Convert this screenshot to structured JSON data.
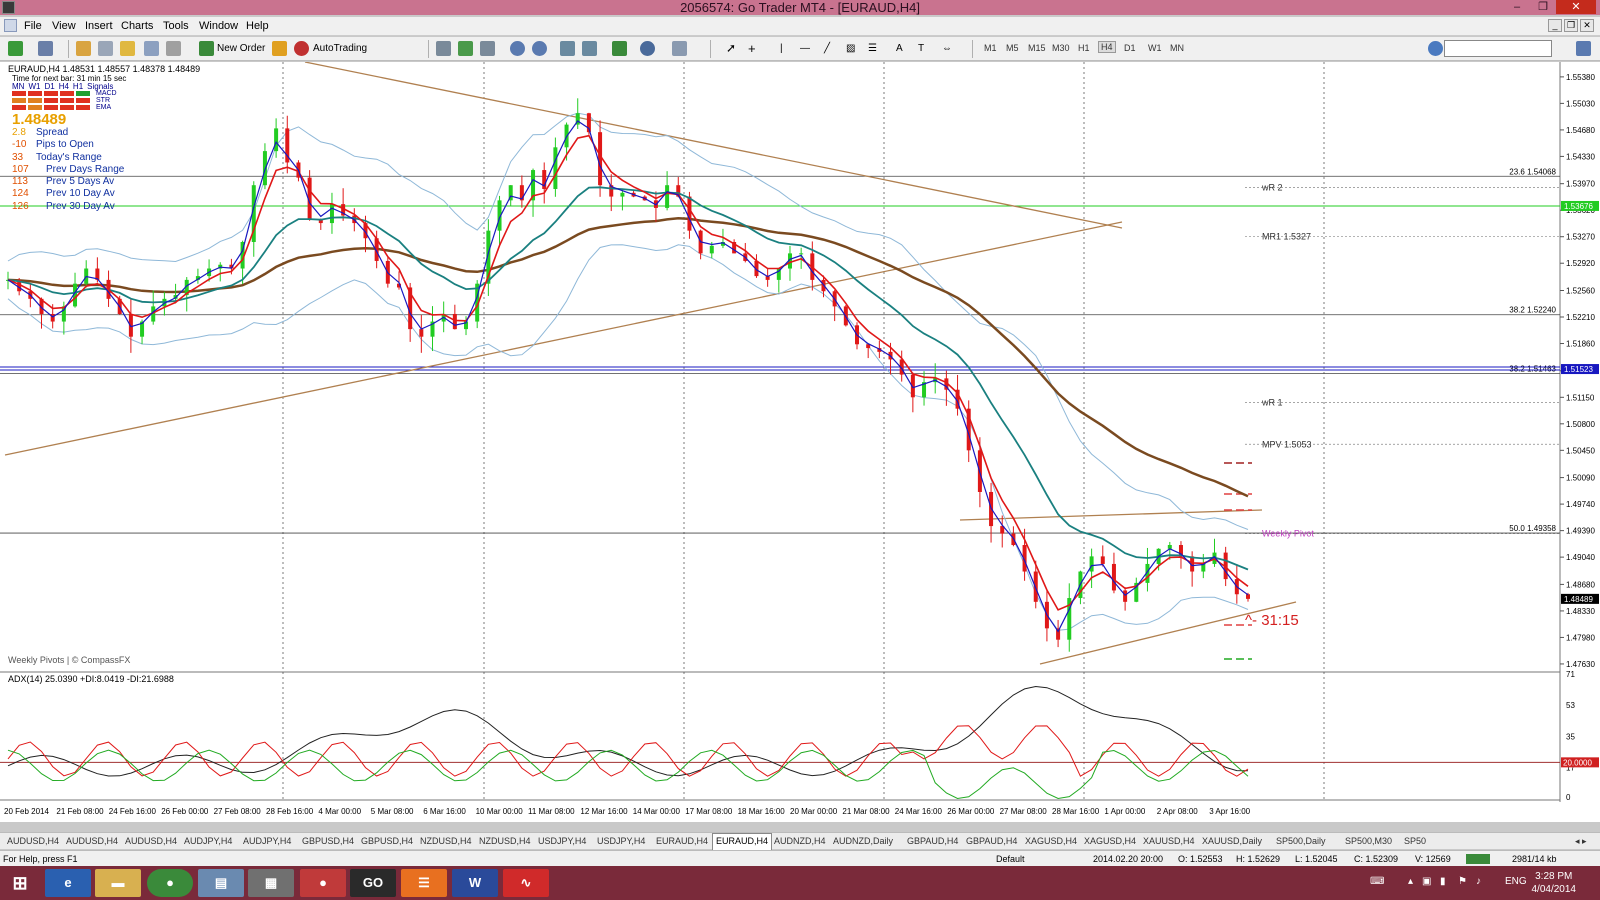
{
  "window": {
    "title": "2056574: Go Trader MT4 - [EURAUD,H4]",
    "buttons": [
      "–",
      "❐",
      "✕"
    ]
  },
  "menu": [
    "File",
    "View",
    "Insert",
    "Charts",
    "Tools",
    "Window",
    "Help"
  ],
  "toolbar": {
    "new_order": "New Order",
    "autotrading": "AutoTrading",
    "timeframes": [
      "M1",
      "M5",
      "M15",
      "M30",
      "H1",
      "H4",
      "D1",
      "W1",
      "MN"
    ],
    "active_timeframe": "H4"
  },
  "chart": {
    "symbol_line": "EURAUD,H4  1.48531 1.48557 1.48378 1.48489",
    "next_bar": "Time for next bar: 31 min 15 sec",
    "signal_headers": [
      "MN",
      "W1",
      "D1",
      "H4",
      "H1",
      "Signals"
    ],
    "signal_rows": [
      "MACD",
      "STR",
      "EMA"
    ],
    "price_big": "1.48489",
    "stats": [
      {
        "value": "2.8",
        "label": "Spread"
      },
      {
        "value": "-10",
        "label": "Pips to Open"
      },
      {
        "value": "33",
        "label": "Today's Range"
      },
      {
        "value": "107",
        "label": "Prev Days Range"
      },
      {
        "value": "113",
        "label": "Prev 5 Days Av"
      },
      {
        "value": "124",
        "label": "Prev 10 Day Av"
      },
      {
        "value": "126",
        "label": "Prev 30 Day Av"
      }
    ],
    "watermark": "Weekly Pivots | © CompassFX",
    "countdown": "^- 31:15",
    "pivot_labels": [
      {
        "text": "wR 2",
        "price": 1.5392
      },
      {
        "text": "MR1   1.5327",
        "price": 1.5327
      },
      {
        "text": "wR 1",
        "price": 1.5108
      },
      {
        "text": "MPV   1.5053",
        "price": 1.5053
      },
      {
        "text": "Weekly Pivot",
        "price": 1.4935
      }
    ],
    "fib_labels": [
      {
        "text": "23.6  1.54068",
        "price": 1.54068
      },
      {
        "text": "38.2  1.52240",
        "price": 1.5224
      },
      {
        "text": "38.2  1.51463",
        "price": 1.51463
      },
      {
        "text": "50.0  1.49358",
        "price": 1.49358
      }
    ],
    "price_axis": [
      "1.55380",
      "1.55030",
      "1.54680",
      "1.54330",
      "1.53970",
      "1.53620",
      "1.53270",
      "1.52920",
      "1.52560",
      "1.52210",
      "1.51860",
      "1.51500",
      "1.51150",
      "1.50800",
      "1.50450",
      "1.50090",
      "1.49740",
      "1.49390",
      "1.49040",
      "1.48680",
      "1.48330",
      "1.47980",
      "1.47630"
    ],
    "price_tags": [
      {
        "text": "1.53676",
        "price": 1.53676,
        "color": "#22cc22"
      },
      {
        "text": "1.51523",
        "price": 1.51523,
        "color": "#1818c0"
      },
      {
        "text": "1.48489",
        "price": 1.48489,
        "color": "#000000"
      }
    ],
    "price_range": [
      1.4755,
      1.5555
    ],
    "time_axis": [
      "20 Feb 2014",
      "21 Feb 08:00",
      "24 Feb 16:00",
      "26 Feb 00:00",
      "27 Feb 08:00",
      "28 Feb 16:00",
      "4 Mar 00:00",
      "5 Mar 08:00",
      "6 Mar 16:00",
      "10 Mar 00:00",
      "11 Mar 08:00",
      "12 Mar 16:00",
      "14 Mar 00:00",
      "17 Mar 08:00",
      "18 Mar 16:00",
      "20 Mar 00:00",
      "21 Mar 08:00",
      "24 Mar 16:00",
      "26 Mar 00:00",
      "27 Mar 08:00",
      "28 Mar 16:00",
      "1 Apr 00:00",
      "2 Apr 08:00",
      "3 Apr 16:00"
    ],
    "adx_label": "ADX(14) 25.0390 +DI:8.0419 -DI:21.6988",
    "adx_axis": [
      "71",
      "53",
      "35",
      "17",
      "0"
    ],
    "adx_tag": "20.0000",
    "close_prices": [
      1.527,
      1.5255,
      1.5245,
      1.5225,
      1.5215,
      1.5235,
      1.5265,
      1.5285,
      1.527,
      1.5245,
      1.5225,
      1.5195,
      1.5215,
      1.5235,
      1.5245,
      1.525,
      1.527,
      1.5275,
      1.5285,
      1.529,
      1.5285,
      1.532,
      1.5395,
      1.544,
      1.547,
      1.5425,
      1.5405,
      1.535,
      1.5345,
      1.537,
      1.5355,
      1.5345,
      1.5325,
      1.5295,
      1.5265,
      1.526,
      1.5205,
      1.5195,
      1.5215,
      1.5225,
      1.5205,
      1.5215,
      1.5265,
      1.5335,
      1.5375,
      1.5395,
      1.5375,
      1.5415,
      1.539,
      1.5445,
      1.5475,
      1.549,
      1.5465,
      1.5395,
      1.538,
      1.5385,
      1.538,
      1.5375,
      1.5365,
      1.5395,
      1.538,
      1.5335,
      1.5305,
      1.5315,
      1.532,
      1.5305,
      1.5295,
      1.5275,
      1.527,
      1.5285,
      1.5305,
      1.5305,
      1.527,
      1.5255,
      1.5235,
      1.521,
      1.5185,
      1.518,
      1.5175,
      1.5165,
      1.5145,
      1.5115,
      1.5135,
      1.514,
      1.5125,
      1.51,
      1.5045,
      1.499,
      1.4945,
      1.4935,
      1.492,
      1.4885,
      1.4845,
      1.481,
      1.4795,
      1.485,
      1.4885,
      1.4905,
      1.4895,
      1.486,
      1.4845,
      1.487,
      1.4895,
      1.4915,
      1.492,
      1.4905,
      1.4885,
      1.4895,
      1.491,
      1.4875,
      1.4855,
      1.48489
    ]
  },
  "symbol_tabs": [
    "AUDUSD,H4",
    "AUDUSD,H4",
    "AUDUSD,H4",
    "AUDJPY,H4",
    "AUDJPY,H4",
    "GBPUSD,H4",
    "GBPUSD,H4",
    "NZDUSD,H4",
    "NZDUSD,H4",
    "USDJPY,H4",
    "USDJPY,H4",
    "EURAUD,H4",
    "EURAUD,H4",
    "AUDNZD,H4",
    "AUDNZD,Daily",
    "GBPAUD,H4",
    "GBPAUD,H4",
    "XAGUSD,H4",
    "XAGUSD,H4",
    "XAUUSD,H4",
    "XAUUSD,Daily",
    "SP500,Daily",
    "SP500,M30",
    "SP50"
  ],
  "active_tab_index": 12,
  "status": {
    "help": "For Help, press F1",
    "profile": "Default",
    "datetime": "2014.02.20 20:00",
    "open": "O: 1.52553",
    "high": "H: 1.52629",
    "low": "L: 1.52045",
    "close": "C: 1.52309",
    "volume": "V: 12569",
    "traffic": "2981/14 kb"
  },
  "taskbar": {
    "lang": "ENG",
    "time": "3:28 PM",
    "date": "4/04/2014",
    "apps": [
      "IE",
      "Explorer",
      "Chrome",
      "Notepad",
      "Calculator",
      "Paint",
      "GO",
      "Orange",
      "W",
      "Monitor"
    ]
  }
}
